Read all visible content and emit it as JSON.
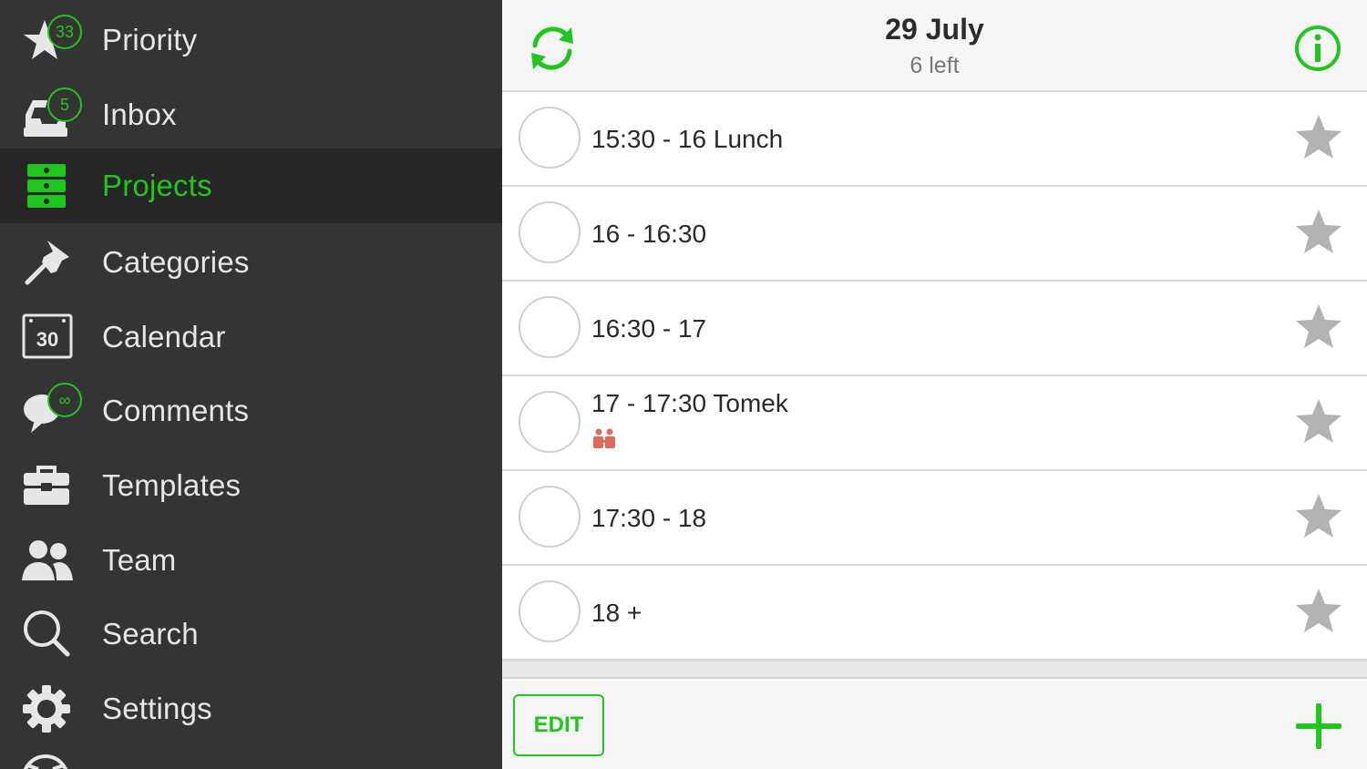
{
  "colors": {
    "accent": "#22c51f",
    "sidebar_bg": "#343434",
    "sidebar_active_bg": "#262626",
    "star_gray": "#b3b3b3",
    "people_red": "#e06a5a"
  },
  "sidebar": {
    "items": [
      {
        "label": "Priority",
        "icon": "star-icon",
        "badge": "33"
      },
      {
        "label": "Inbox",
        "icon": "inbox-tray-icon",
        "badge": "5"
      },
      {
        "label": "Projects",
        "icon": "projects-icon",
        "active": true
      },
      {
        "label": "Categories",
        "icon": "pin-icon"
      },
      {
        "label": "Calendar",
        "icon": "calendar-icon",
        "icon_text": "30"
      },
      {
        "label": "Comments",
        "icon": "comment-bubble-icon",
        "badge": "∞"
      },
      {
        "label": "Templates",
        "icon": "toolbox-icon"
      },
      {
        "label": "Team",
        "icon": "team-icon"
      },
      {
        "label": "Search",
        "icon": "search-icon"
      },
      {
        "label": "Settings",
        "icon": "gear-icon"
      }
    ]
  },
  "header": {
    "title": "29 July",
    "subtitle": "6 left"
  },
  "tasks": [
    {
      "title": "15:30 - 16 Lunch"
    },
    {
      "title": "16 - 16:30"
    },
    {
      "title": "16:30 - 17"
    },
    {
      "title": "17 - 17:30 Tomek",
      "has_people": true
    },
    {
      "title": "17:30 - 18"
    },
    {
      "title": "18 +"
    }
  ],
  "footer": {
    "edit_label": "EDIT"
  }
}
